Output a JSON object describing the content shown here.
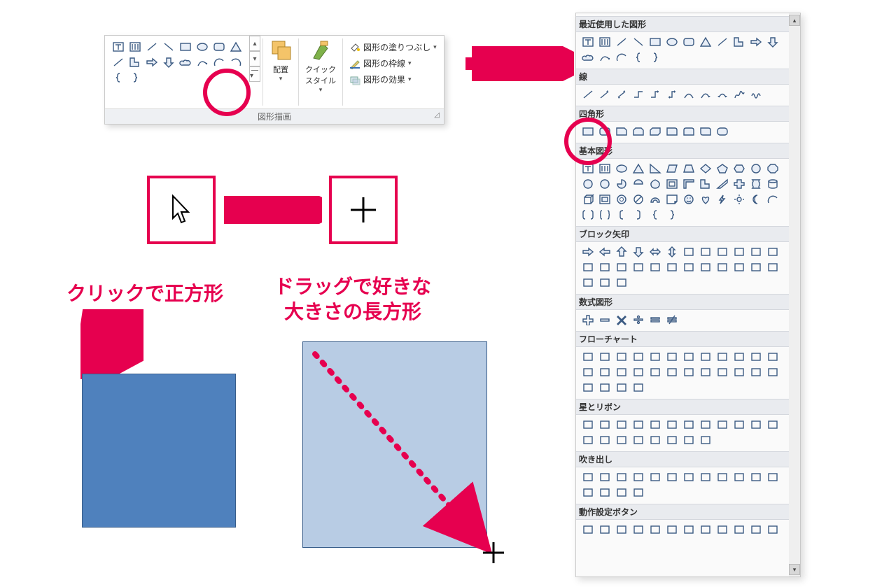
{
  "ribbon": {
    "arrange_label": "配置",
    "quick_style_label": "クイック\nスタイル",
    "fill_label": "図形の塗りつぶし",
    "outline_label": "図形の枠線",
    "effects_label": "図形の効果",
    "group_label": "図形描画",
    "gallery_shapes": [
      "text-box",
      "picture-placeholder",
      "line",
      "line-alt",
      "rectangle",
      "oval",
      "rounded-rect",
      "triangle",
      "line",
      "l-shape",
      "arrow-right",
      "arrow-down",
      "cloud",
      "connector-curve",
      "arc",
      "arc-2",
      "brace-left",
      "brace-right"
    ]
  },
  "annotations": {
    "click_text": "クリックで正方形",
    "drag_text": "ドラッグで好きな\n大きさの長方形"
  },
  "shapes_panel": {
    "sections": [
      {
        "title": "最近使用した図形",
        "shapes": [
          "text-box",
          "picture-placeholder",
          "line",
          "line-alt",
          "rectangle",
          "oval",
          "rounded-rect",
          "triangle",
          "line",
          "l-shape",
          "arrow-right",
          "arrow-down",
          "cloud",
          "connector-curve",
          "arc",
          "brace-left",
          "brace-right"
        ]
      },
      {
        "title": "線",
        "shapes": [
          "line",
          "line-arrow",
          "line-double-arrow",
          "elbow",
          "elbow-arrow",
          "elbow-double",
          "curve",
          "curve-arrow",
          "curve-double",
          "freeform",
          "scribble"
        ]
      },
      {
        "title": "四角形",
        "shapes": [
          "rectangle",
          "rounded-rect",
          "snip-single",
          "snip-same",
          "snip-diag",
          "round-single",
          "round-same",
          "round-diag",
          "round-all"
        ]
      },
      {
        "title": "基本図形",
        "shapes": [
          "text-box",
          "picture-placeholder",
          "oval",
          "triangle",
          "right-triangle",
          "parallelogram",
          "trapezoid",
          "diamond",
          "pentagon",
          "hexagon",
          "heptagon",
          "octagon",
          "decagon",
          "dodecagon",
          "pie",
          "chord",
          "teardrop",
          "frame",
          "half-frame",
          "l-shape",
          "diag-stripe",
          "cross",
          "plaque",
          "can",
          "cube",
          "bevel",
          "donut",
          "no-symbol",
          "block-arc",
          "folded-corner",
          "smiley",
          "heart",
          "lightning",
          "sun",
          "moon",
          "arc",
          "double-bracket",
          "double-brace",
          "left-bracket",
          "right-bracket",
          "left-brace",
          "right-brace"
        ]
      },
      {
        "title": "ブロック矢印",
        "shapes": [
          "arrow-right",
          "arrow-left",
          "arrow-up",
          "arrow-down",
          "arrow-lr",
          "arrow-ud",
          "quad-arrow",
          "lrud",
          "bent-l",
          "bent-r",
          "u-turn",
          "l-up",
          "bent-up",
          "curved-right",
          "curved-left",
          "curved-up",
          "curved-down",
          "striped-right",
          "notched-right",
          "pentagon-arrow",
          "chevron",
          "callout-right",
          "callout-lr",
          "callout-quad",
          "cross-arrow",
          "plus-arrow",
          "circular"
        ]
      },
      {
        "title": "数式図形",
        "shapes": [
          "plus",
          "minus",
          "multiply",
          "divide",
          "equal",
          "not-equal"
        ]
      },
      {
        "title": "フローチャート",
        "shapes": [
          "process",
          "alt-process",
          "decision",
          "data",
          "predefined",
          "internal-storage",
          "document",
          "multi-doc",
          "terminator",
          "preparation",
          "manual-input",
          "manual-op",
          "connector",
          "off-page",
          "card",
          "punched-tape",
          "summing",
          "or",
          "collate",
          "sort",
          "extract",
          "merge",
          "stored-data",
          "delay",
          "seq-access",
          "magnetic-disk",
          "direct-access",
          "display"
        ]
      },
      {
        "title": "星とリボン",
        "shapes": [
          "explosion1",
          "explosion2",
          "star4",
          "star5",
          "star6",
          "star7",
          "star8",
          "star10",
          "star12",
          "star16",
          "star24",
          "star32",
          "ribbon-up",
          "ribbon-down",
          "ribbon-curved-up",
          "ribbon-curved-down",
          "vertical-scroll",
          "horizontal-scroll",
          "wave",
          "double-wave"
        ]
      },
      {
        "title": "吹き出し",
        "shapes": [
          "rect-callout",
          "round-rect-callout",
          "oval-callout",
          "cloud-callout",
          "line-callout1",
          "line-callout2",
          "line-callout3",
          "line-callout1-accent",
          "line-callout2-accent",
          "line-callout3-accent",
          "line-callout1-noborder",
          "line-callout2-noborder",
          "line-callout3-noborder",
          "line-callout1-border-accent",
          "line-callout2-border-accent",
          "line-callout3-border-accent"
        ]
      },
      {
        "title": "動作設定ボタン",
        "shapes": [
          "action-back",
          "action-forward",
          "action-beginning",
          "action-end",
          "action-home",
          "action-info",
          "action-return",
          "action-movie",
          "action-document",
          "action-sound",
          "action-help",
          "action-blank"
        ]
      }
    ]
  }
}
